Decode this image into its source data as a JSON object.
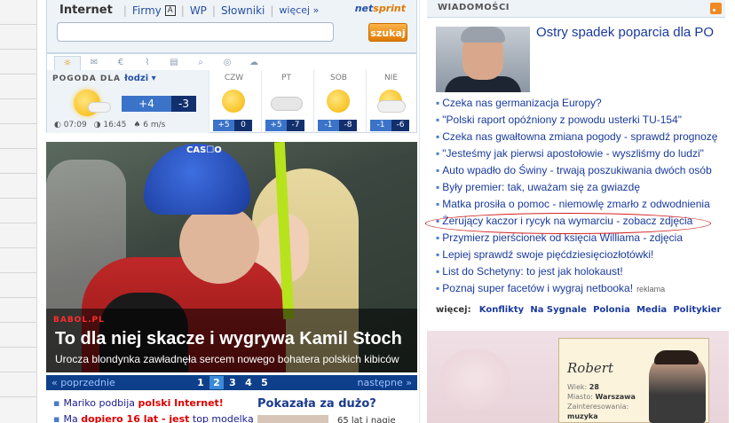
{
  "search": {
    "nav": [
      "Internet",
      "Firmy",
      "WP",
      "Słowniki",
      "więcej »"
    ],
    "firmy_icon": "book-icon",
    "brand_net": "net",
    "brand_sprint": "sprint",
    "placeholder": "",
    "button": "szukaj"
  },
  "weather": {
    "tabs": [
      "sun-icon",
      "mail-icon",
      "euro-icon",
      "chart-icon",
      "calendar-icon",
      "magnifier-icon",
      "planet-icon",
      "cloud-icon"
    ],
    "label_prefix": "POGODA DLA",
    "city": "łodzi ▾",
    "today": {
      "hi": "+4",
      "lo": "-3",
      "sunrise": "07:09",
      "sunset": "16:45",
      "wind": "6 m/s"
    },
    "days": [
      {
        "name": "CZW",
        "icon": "sun",
        "hi": "+5",
        "lo": "0"
      },
      {
        "name": "PT",
        "icon": "cloudy",
        "hi": "+5",
        "lo": "-7"
      },
      {
        "name": "SOB",
        "icon": "sun",
        "hi": "-1",
        "lo": "-8"
      },
      {
        "name": "NIE",
        "icon": "partly",
        "hi": "-1",
        "lo": "-6"
      }
    ]
  },
  "hero": {
    "helmet_text": "CAS☐O",
    "badge": "BABOL.PL",
    "headline": "To dla niej skacze i wygrywa Kamil Stoch",
    "sub": "Urocza blondynka zawładnęła sercem nowego bohatera polskich kibiców"
  },
  "pager": {
    "prev": "« poprzednie",
    "next": "następne »",
    "pages": [
      "1",
      "2",
      "3",
      "4",
      "5"
    ],
    "active": "2"
  },
  "bottom": {
    "item1_pre": "Mariko podbija ",
    "item1_bold": "polski Internet!",
    "item2_pre": "Ma ",
    "item2_bold": "dopiero 16 lat - jest",
    "item2_post": " top modelką",
    "pokazala": "Pokazała za dużo?",
    "pokazala_txt": "65 lat i nagie"
  },
  "news": {
    "header": "WIADOMOŚCI",
    "top_title": "Ostry spadek poparcia dla PO",
    "items": [
      "Czeka nas germanizacja Europy?",
      "\"Polski raport opóźniony z powodu usterki TU-154\"",
      "Czeka nas gwałtowna zmiana pogody - sprawdź prognozę",
      "\"Jesteśmy jak pierwsi apostołowie - wyszliśmy do ludzi\"",
      "Auto wpadło do Świny - trwają poszukiwania dwóch osób",
      "Były premier: tak, uważam się za gwiazdę",
      "Matka prosiła o pomoc - niemowlę zmarło z odwodnienia",
      "Żerujący kaczor i rycyk na wymarciu - zobacz zdjęcia",
      "Przymierz pierścionek od księcia Williama - zdjęcia",
      "Lepiej sprawdź swoje pięćdziesięciozłotówki!",
      "List do Schetyny: to jest jak holokaust!",
      "Poznaj super facetów i wygraj netbooka!"
    ],
    "ad_tag": "reklama",
    "more_label": "więcej:",
    "more_links": [
      "Konflikty",
      "Na Sygnale",
      "Polonia",
      "Media",
      "Polityk",
      "ier"
    ]
  },
  "ad": {
    "name": "Robert",
    "wiek_label": "Wiek:",
    "wiek": "28",
    "miasto_label": "Miasto:",
    "miasto": "Warszawa",
    "zaint_label": "Zainteresowania:",
    "zaint": "muzyka"
  }
}
